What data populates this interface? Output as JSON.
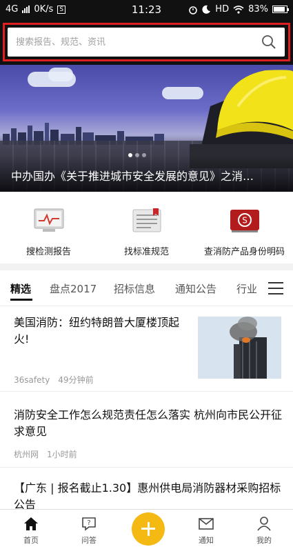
{
  "status_bar": {
    "network": "4G",
    "speed": "0K/s",
    "time": "11:23",
    "hd": "HD",
    "battery": "83%"
  },
  "search": {
    "placeholder": "搜索报告、规范、资讯"
  },
  "banner": {
    "caption": "中办国办《关于推进城市安全发展的意见》之消…"
  },
  "quick_links": [
    {
      "label": "搜检测报告",
      "icon": "monitor-report-icon"
    },
    {
      "label": "找标准规范",
      "icon": "document-icon"
    },
    {
      "label": "查消防产品身份明码",
      "icon": "id-card-icon"
    }
  ],
  "tabs": [
    {
      "label": "精选",
      "active": true
    },
    {
      "label": "盘点2017"
    },
    {
      "label": "招标信息"
    },
    {
      "label": "通知公告"
    },
    {
      "label": "行业"
    }
  ],
  "articles": [
    {
      "title": "美国消防：纽约特朗普大厦楼顶起火!",
      "source": "36safety",
      "time": "49分钟前",
      "has_thumb": true
    },
    {
      "title": "消防安全工作怎么规范责任怎么落实 杭州向市民公开征求意见",
      "source": "杭州网",
      "time": "1小时前"
    },
    {
      "title": "【广东 | 报名截止1.30】惠州供电局消防器材采购招标公告"
    }
  ],
  "bottom_nav": [
    {
      "label": "首页",
      "icon": "home-icon"
    },
    {
      "label": "问答",
      "icon": "question-chat-icon"
    },
    {
      "label": "通知",
      "icon": "mail-icon"
    },
    {
      "label": "我的",
      "icon": "user-icon"
    }
  ],
  "colors": {
    "search_highlight": "#e02020",
    "fab": "#f5b914",
    "status_bar": "#111111"
  }
}
